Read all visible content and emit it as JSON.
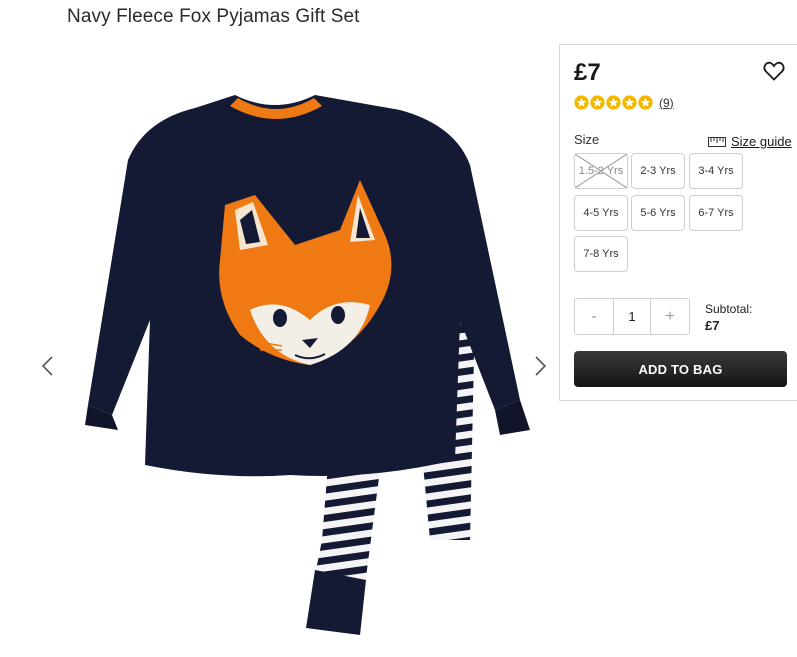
{
  "product": {
    "title": "Navy Fleece Fox Pyjamas Gift Set",
    "image_alt": "Navy fleece fox pyjama top with striped bottoms"
  },
  "gallery": {
    "prev_icon": "chevron-left-icon",
    "next_icon": "chevron-right-icon"
  },
  "purchase": {
    "price": "£7",
    "rating": {
      "stars": 5,
      "count": "(9)",
      "star_color": "#f2b600"
    },
    "size_label": "Size",
    "size_guide_label": "Size guide",
    "sizes": [
      {
        "label": "1.5-2 Yrs",
        "available": false
      },
      {
        "label": "2-3 Yrs",
        "available": true
      },
      {
        "label": "3-4 Yrs",
        "available": true
      },
      {
        "label": "4-5 Yrs",
        "available": true
      },
      {
        "label": "5-6 Yrs",
        "available": true
      },
      {
        "label": "6-7 Yrs",
        "available": true
      },
      {
        "label": "7-8 Yrs",
        "available": true
      }
    ],
    "quantity": {
      "minus": "-",
      "value": "1",
      "plus": "+"
    },
    "subtotal_label": "Subtotal:",
    "subtotal_value": "£7",
    "add_to_bag_label": "ADD TO BAG"
  },
  "colors": {
    "navy": "#141a33",
    "fox_orange": "#ef7a14",
    "button_dark": "#1f1f1f"
  }
}
